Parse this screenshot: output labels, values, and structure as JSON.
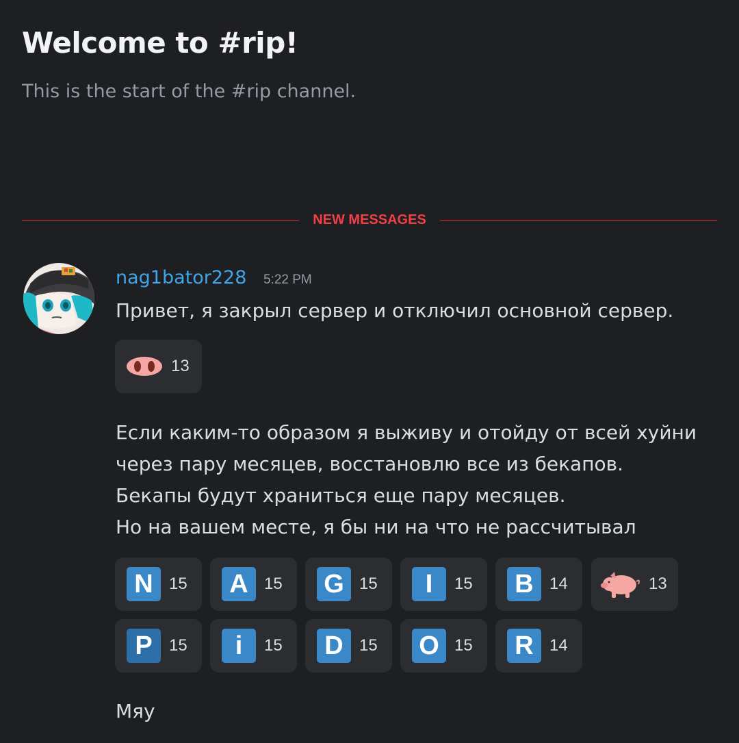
{
  "channel": {
    "welcome_title": "Welcome to #rip!",
    "welcome_subtitle": "This is the start of the #rip channel."
  },
  "divider": {
    "label": "NEW MESSAGES",
    "color": "#f23f43"
  },
  "message": {
    "author": "nag1bator228",
    "timestamp": "5:22 PM",
    "first_line": "Привет, я закрыл сервер и отключил основной сервер.",
    "first_reaction": {
      "emoji": "pig-nose-icon",
      "count": "13"
    },
    "paragraph": [
      "Если каким-то образом я выживу и отойду от всей хуйни",
      "через пару месяцев, восстановлю все из бекапов.",
      "Бекапы будут храниться еще пару месяцев.",
      "Но на вашем месте, я бы ни на что не рассчитывал"
    ],
    "reactions_row1": [
      {
        "letter": "N",
        "count": "15"
      },
      {
        "letter": "A",
        "count": "15"
      },
      {
        "letter": "G",
        "count": "15"
      },
      {
        "letter": "I",
        "count": "15"
      },
      {
        "letter": "B",
        "count": "14"
      },
      {
        "emoji": "pig-icon",
        "count": "13"
      }
    ],
    "reactions_row2": [
      {
        "letter": "P",
        "count": "15"
      },
      {
        "letter": "i",
        "count": "15"
      },
      {
        "letter": "D",
        "count": "15"
      },
      {
        "letter": "O",
        "count": "15"
      },
      {
        "letter": "R",
        "count": "14"
      }
    ],
    "last_line": "Мяу"
  },
  "colors": {
    "background": "#1e1f23",
    "username": "#3ea5e8",
    "reaction_bg": "#2b2d31",
    "letter_tile": "#3a88c7"
  }
}
